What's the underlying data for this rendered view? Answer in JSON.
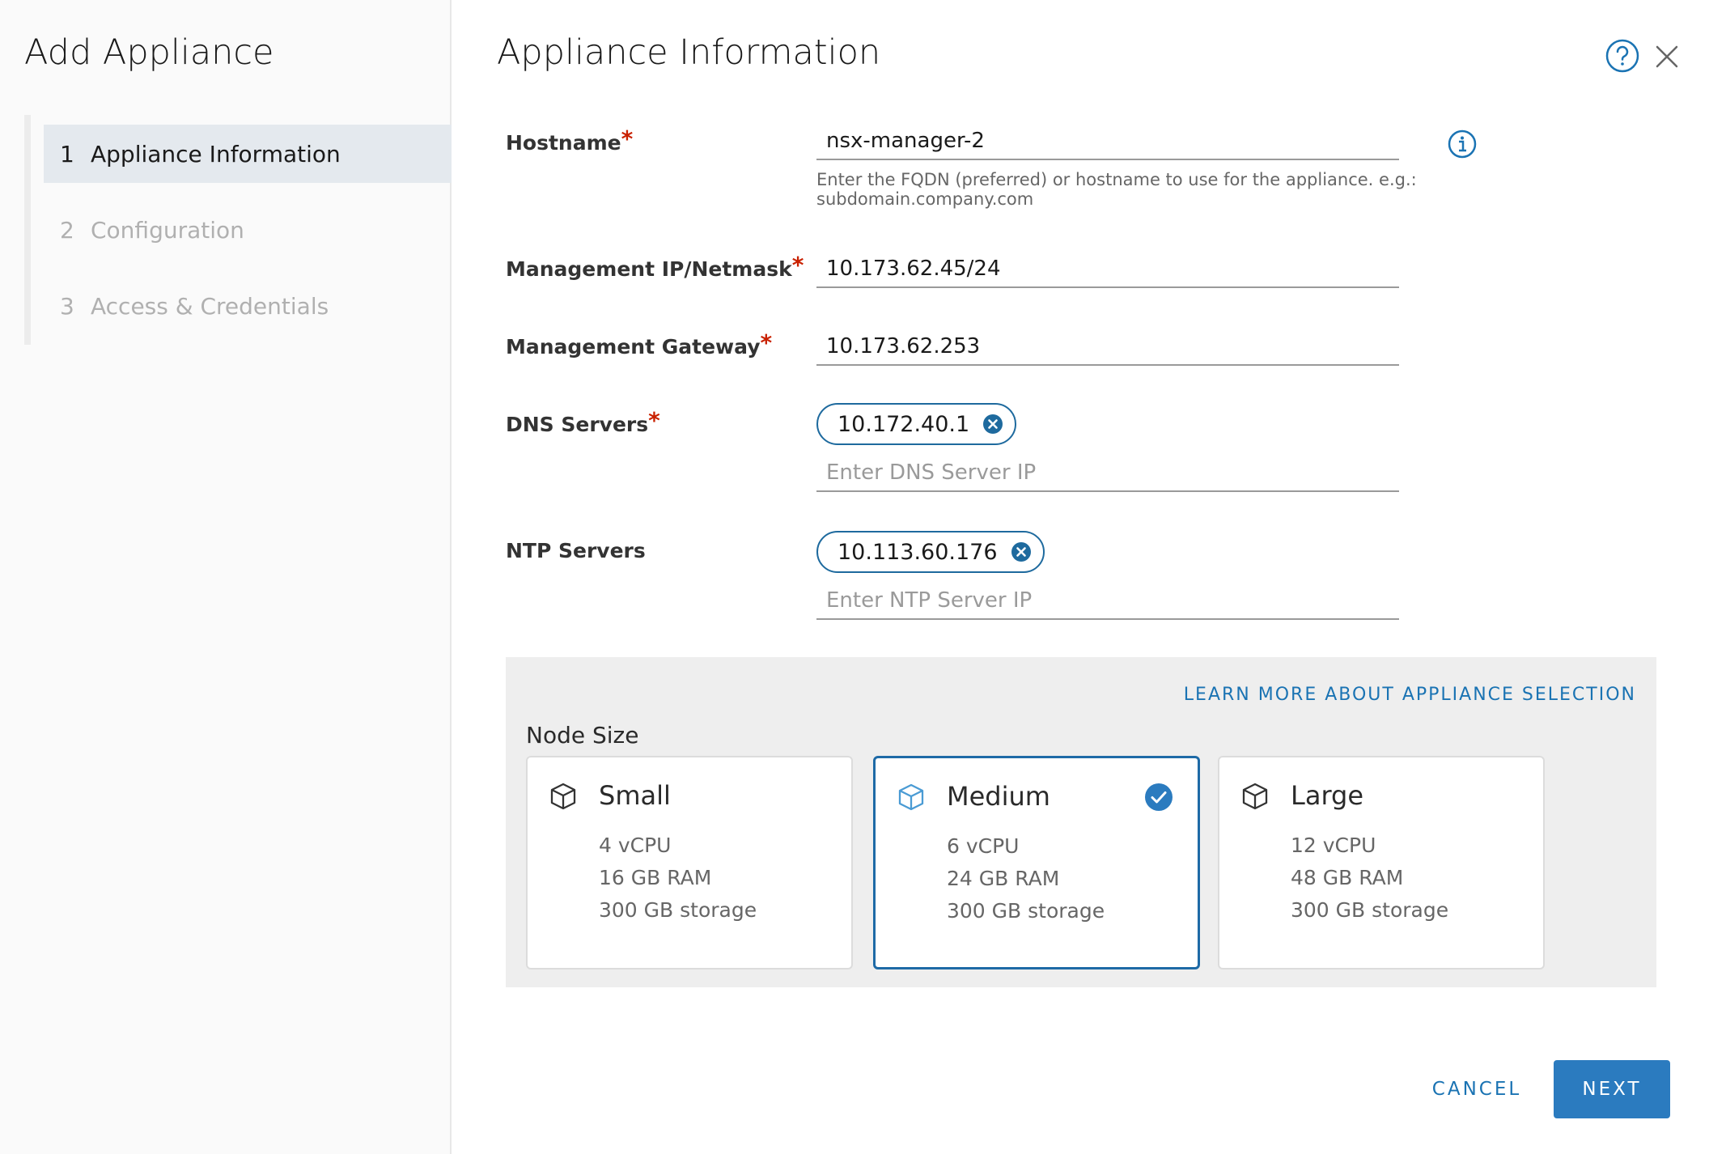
{
  "sidebar": {
    "title": "Add Appliance",
    "steps": [
      {
        "num": "1",
        "label": "Appliance Information"
      },
      {
        "num": "2",
        "label": "Configuration"
      },
      {
        "num": "3",
        "label": "Access & Credentials"
      }
    ]
  },
  "main": {
    "title": "Appliance Information",
    "hostname": {
      "label": "Hostname",
      "value": "nsx-manager-2",
      "helper_line1": "Enter the FQDN (preferred) or hostname to use for the appliance. e.g.:",
      "helper_line2": "subdomain.company.com"
    },
    "mgmt_ip": {
      "label": "Management IP/Netmask",
      "value": "10.173.62.45/24"
    },
    "mgmt_gateway": {
      "label": "Management Gateway",
      "value": "10.173.62.253"
    },
    "dns": {
      "label": "DNS Servers",
      "chip": "10.172.40.1",
      "placeholder": "Enter DNS Server IP"
    },
    "ntp": {
      "label": "NTP Servers",
      "chip": "10.113.60.176",
      "placeholder": "Enter NTP Server IP"
    },
    "required_mark": "*"
  },
  "node_size": {
    "label": "Node Size",
    "learn_more": "LEARN MORE ABOUT APPLIANCE SELECTION",
    "options": [
      {
        "title": "Small",
        "cpu": "4 vCPU",
        "ram": "16 GB RAM",
        "storage": "300 GB storage",
        "selected": false
      },
      {
        "title": "Medium",
        "cpu": "6 vCPU",
        "ram": "24 GB RAM",
        "storage": "300 GB storage",
        "selected": true
      },
      {
        "title": "Large",
        "cpu": "12 vCPU",
        "ram": "48 GB RAM",
        "storage": "300 GB storage",
        "selected": false
      }
    ]
  },
  "footer": {
    "cancel": "CANCEL",
    "next": "NEXT"
  },
  "colors": {
    "accent": "#1a73b3",
    "primary_button": "#2b7bbf",
    "required": "#c92100"
  },
  "icons": {
    "help": "help-circle-icon",
    "close": "close-icon",
    "info": "info-circle-icon",
    "cube": "cube-icon",
    "check": "check-circle-icon",
    "chip_remove": "remove-circle-icon"
  }
}
